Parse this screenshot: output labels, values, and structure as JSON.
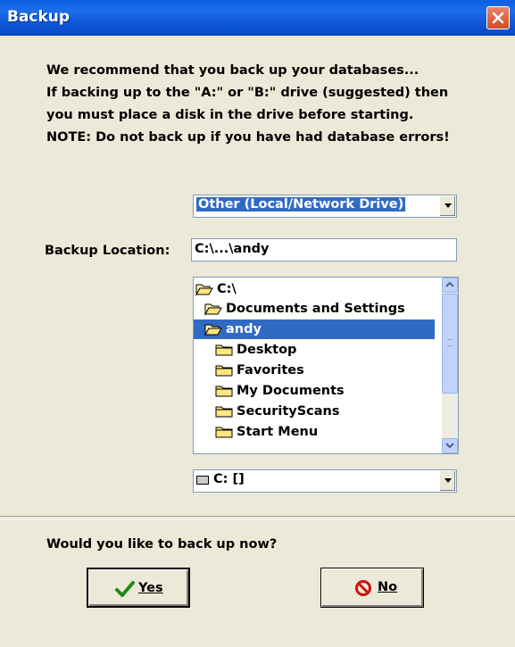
{
  "window": {
    "title": "Backup"
  },
  "message": {
    "lines": [
      "We recommend that you back up your databases...",
      "If backing up to the \"A:\" or \"B:\" drive (suggested) then",
      "you must place a disk in the drive before starting.",
      "NOTE: Do not back up if you have had database errors!"
    ]
  },
  "drive_type": {
    "selected": "Other (Local/Network Drive)"
  },
  "backup_location": {
    "label": "Backup Location:",
    "value": "C:\\...\\andy"
  },
  "directory_list": {
    "items": [
      {
        "label": "C:\\",
        "icon": "folder-open-icon",
        "selected": false
      },
      {
        "label": "Documents and Settings",
        "icon": "folder-open-icon",
        "selected": false
      },
      {
        "label": "andy",
        "icon": "folder-open-icon",
        "selected": true
      },
      {
        "label": "Desktop",
        "icon": "folder-icon",
        "selected": false
      },
      {
        "label": "Favorites",
        "icon": "folder-icon",
        "selected": false
      },
      {
        "label": "My Documents",
        "icon": "folder-icon",
        "selected": false
      },
      {
        "label": "SecurityScans",
        "icon": "folder-icon",
        "selected": false
      },
      {
        "label": "Start Menu",
        "icon": "folder-icon",
        "selected": false
      }
    ]
  },
  "drive_select": {
    "selected": "C: []",
    "icon": "drive-icon"
  },
  "prompt": {
    "question": "Would you like to back up now?"
  },
  "buttons": {
    "yes": {
      "label": "Yes",
      "icon": "checkmark-icon"
    },
    "no": {
      "label": "No",
      "icon": "cancel-icon"
    }
  },
  "colors": {
    "title_bar": "#0a5ee0",
    "selection": "#316ac5",
    "dialog_bg": "#ece9d8"
  }
}
